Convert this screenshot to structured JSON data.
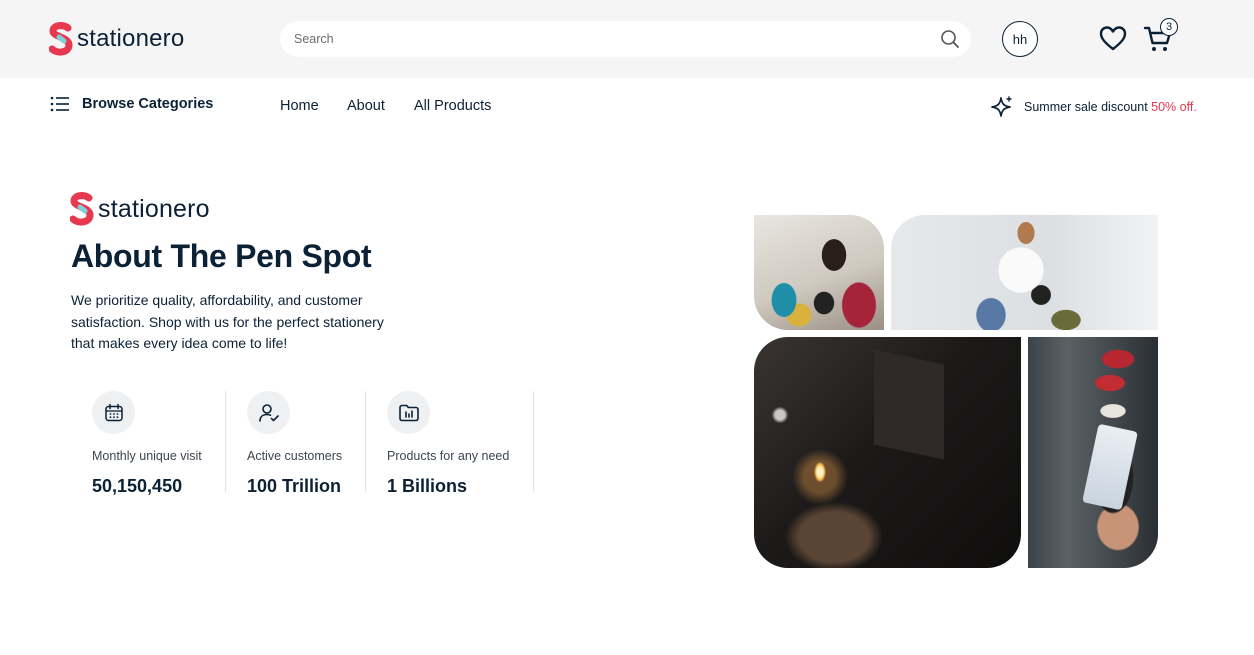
{
  "brand": {
    "name": "stationero",
    "colors": {
      "accent": "#e8384f",
      "secondary": "#7fd1d9",
      "text": "#0b2136"
    }
  },
  "header": {
    "search": {
      "placeholder": "Search",
      "value": ""
    },
    "user": {
      "initials": "hh"
    },
    "cart": {
      "count": "3"
    },
    "icons": [
      "search-icon",
      "heart-icon",
      "cart-icon"
    ]
  },
  "nav": {
    "browse_label": "Browse Categories",
    "links": [
      {
        "label": "Home"
      },
      {
        "label": "About"
      },
      {
        "label": "All Products"
      }
    ],
    "promo": {
      "text": "Summer sale discount",
      "highlight": "50% off."
    }
  },
  "hero": {
    "title": "About The Pen Spot",
    "description": "We prioritize quality, affordability, and customer satisfaction. Shop with us for the perfect stationery that makes every idea come to life!",
    "stats": [
      {
        "icon": "calendar-icon",
        "label": "Monthly unique visit",
        "value": "50,150,450"
      },
      {
        "icon": "user-check-icon",
        "label": "Active customers",
        "value": "100 Trillion"
      },
      {
        "icon": "folder-chart-icon",
        "label": "Products for any need",
        "value": "1 Billions"
      }
    ]
  }
}
